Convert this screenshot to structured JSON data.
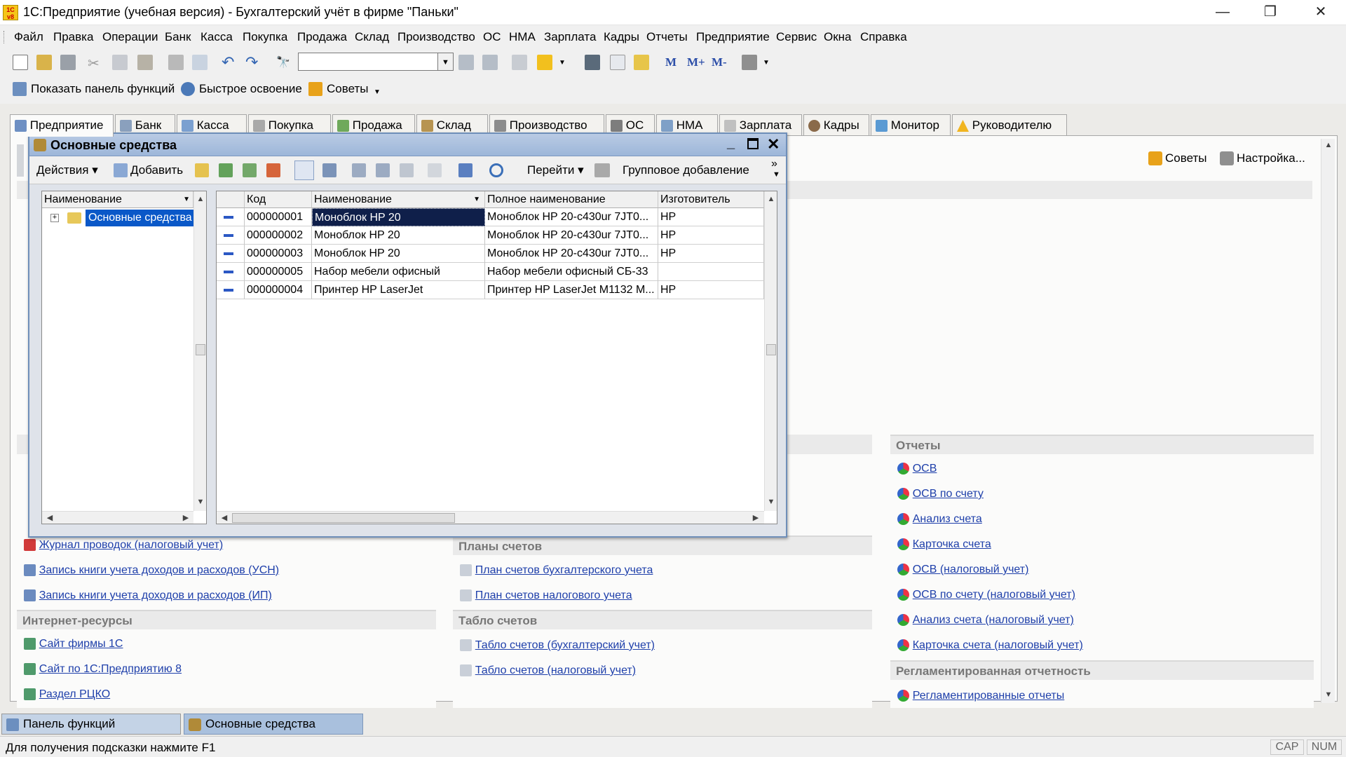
{
  "window": {
    "title": "1С:Предприятие (учебная версия) - Бухгалтерский учёт в фирме \"Паньки\"",
    "minimize": "—",
    "restore": "❐",
    "close": "✕"
  },
  "menu": [
    "Файл",
    "Правка",
    "Операции",
    "Банк",
    "Касса",
    "Покупка",
    "Продажа",
    "Склад",
    "Производство",
    "ОС",
    "НМА",
    "Зарплата",
    "Кадры",
    "Отчеты",
    "Предприятие",
    "Сервис",
    "Окна",
    "Справка"
  ],
  "toolbar1": {
    "search_value": "",
    "m": "M",
    "mplus": "M+",
    "mminus": "M-"
  },
  "toolbar2": {
    "show_panel": "Показать панель функций",
    "quick": "Быстрое освоение",
    "tips": "Советы"
  },
  "tabs": [
    "Предприятие",
    "Банк",
    "Касса",
    "Покупка",
    "Продажа",
    "Склад",
    "Производство",
    "ОС",
    "НМА",
    "Зарплата",
    "Кадры",
    "Монитор",
    "Руководителю"
  ],
  "panel": {
    "tips": "Советы",
    "settings": "Настройка...",
    "left_links": [
      "Журнал проводок (налоговый учет)",
      "Запись книги учета доходов и расходов (УСН)",
      "Запись книги учета доходов и расходов (ИП)"
    ],
    "internet_header": "Интернет-ресурсы",
    "internet_links": [
      "Сайт фирмы 1С",
      "Сайт по 1С:Предприятию 8",
      "Раздел РЦКО"
    ],
    "plans_header": "Планы счетов",
    "plans_links": [
      "План счетов бухгалтерского учета",
      "План счетов налогового учета"
    ],
    "tablo_header": "Табло счетов",
    "tablo_links": [
      "Табло счетов (бухгалтерский учет)",
      "Табло счетов (налоговый учет)"
    ],
    "reports_header": "Отчеты",
    "reports_links": [
      "ОСВ",
      "ОСВ по счету",
      "Анализ счета",
      "Карточка счета",
      "ОСВ (налоговый учет)",
      "ОСВ по счету (налоговый учет)",
      "Анализ счета (налоговый учет)",
      "Карточка счета (налоговый учет)"
    ],
    "reg_header": "Регламентированная отчетность",
    "reg_links": [
      "Регламентированные отчеты"
    ]
  },
  "dialog": {
    "title": "Основные средства",
    "actions": "Действия",
    "add": "Добавить",
    "goto": "Перейти",
    "group_add": "Групповое добавление",
    "tree_header": "Наименование",
    "tree_root": "Основные средства",
    "columns": [
      "Код",
      "Наименование",
      "Полное наименование",
      "Изготовитель"
    ],
    "rows": [
      {
        "code": "000000001",
        "name": "Моноблок HP 20",
        "full": "Моноблок HP 20-c430ur 7JT0...",
        "maker": "HP"
      },
      {
        "code": "000000002",
        "name": "Моноблок HP 20",
        "full": "Моноблок HP 20-c430ur 7JT0...",
        "maker": "HP"
      },
      {
        "code": "000000003",
        "name": "Моноблок HP 20",
        "full": "Моноблок HP 20-c430ur 7JT0...",
        "maker": "HP"
      },
      {
        "code": "000000005",
        "name": "Набор мебели офисный",
        "full": "Набор мебели офисный СБ-33",
        "maker": ""
      },
      {
        "code": "000000004",
        "name": "Принтер HP LaserJet",
        "full": "Принтер HP LaserJet M1132 M...",
        "maker": "HP"
      }
    ]
  },
  "taskbar": [
    "Панель функций",
    "Основные средства"
  ],
  "status": {
    "hint": "Для получения подсказки нажмите F1",
    "cap": "CAP",
    "num": "NUM"
  }
}
